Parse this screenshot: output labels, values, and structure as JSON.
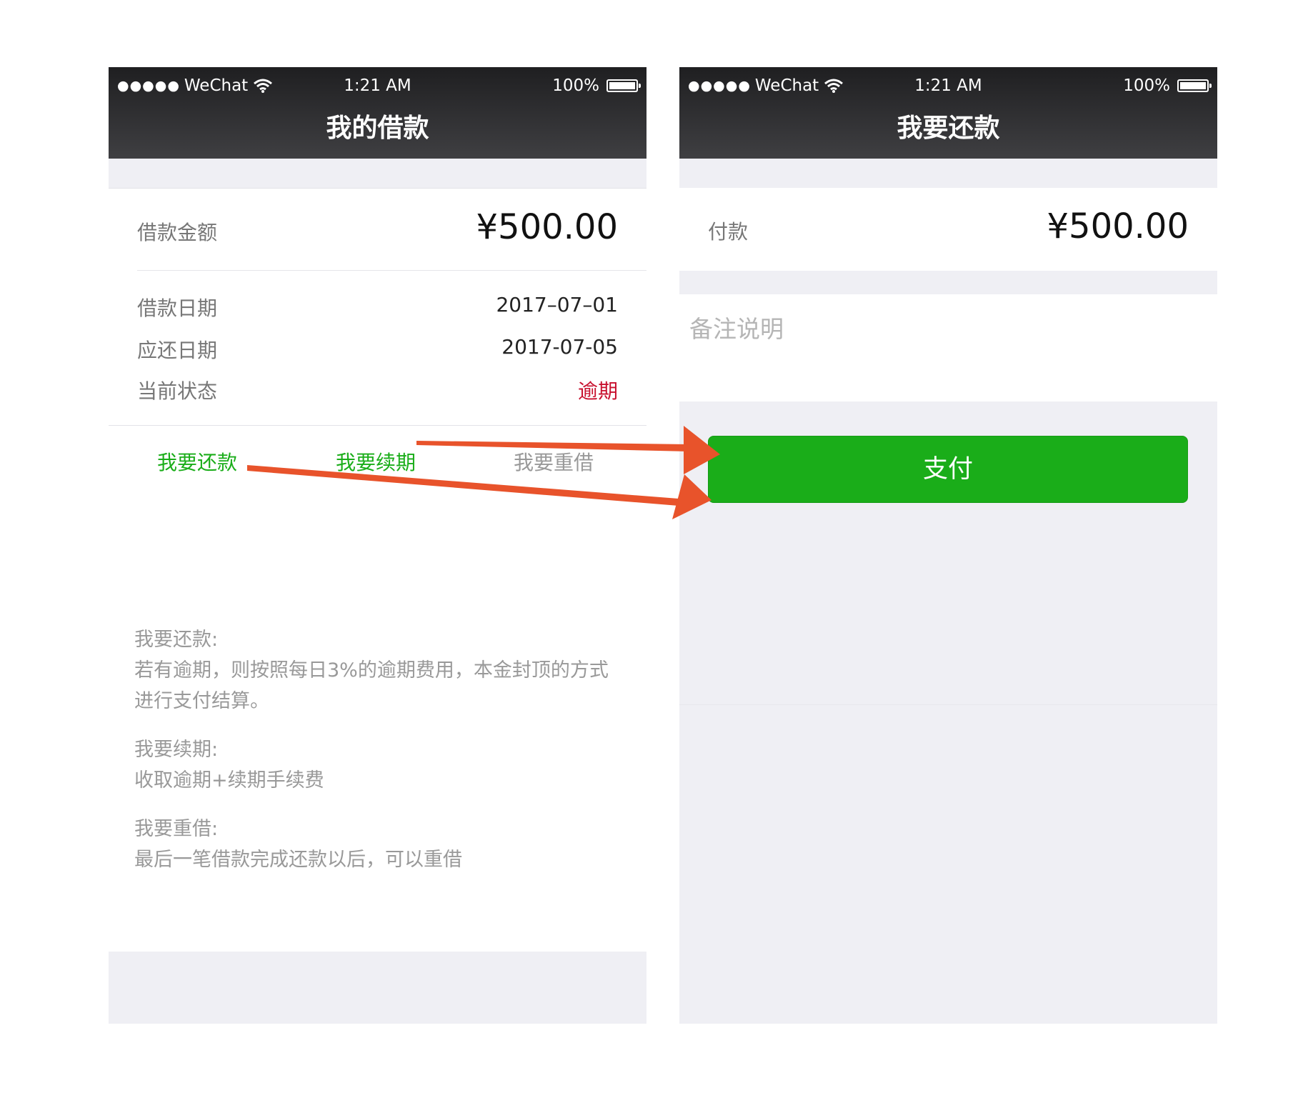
{
  "status_bar": {
    "signal_dots": "●●●●●",
    "carrier": "WeChat",
    "time": "1:21 AM",
    "battery": "100%"
  },
  "loan_screen": {
    "title": "我的借款",
    "amount_label": "借款金额",
    "amount_value": "¥500.00",
    "rows": [
      {
        "label": "借款日期",
        "value": "2017–07–01"
      },
      {
        "label": "应还日期",
        "value": "2017-07-05"
      },
      {
        "label": "当前状态",
        "value": "逾期"
      }
    ],
    "actions": [
      "我要还款",
      "我要续期",
      "我要重借"
    ],
    "notes": [
      {
        "title": "我要还款:",
        "body": "若有逾期，则按照每日3%的逾期费用，本金封顶的方式进行支付结算。"
      },
      {
        "title": "我要续期:",
        "body": "收取逾期+续期手续费"
      },
      {
        "title": "我要重借:",
        "body": "最后一笔借款完成还款以后，可以重借"
      }
    ]
  },
  "repay_screen": {
    "title": "我要还款",
    "pay_label": "付款",
    "pay_amount": "¥500.00",
    "memo_placeholder": "备注说明",
    "pay_button": "支付"
  },
  "colors": {
    "accent_green": "#1aad19",
    "overdue_red": "#c8102e",
    "arrow": "#e8532b",
    "nav_dark": "#2c2c2e"
  }
}
